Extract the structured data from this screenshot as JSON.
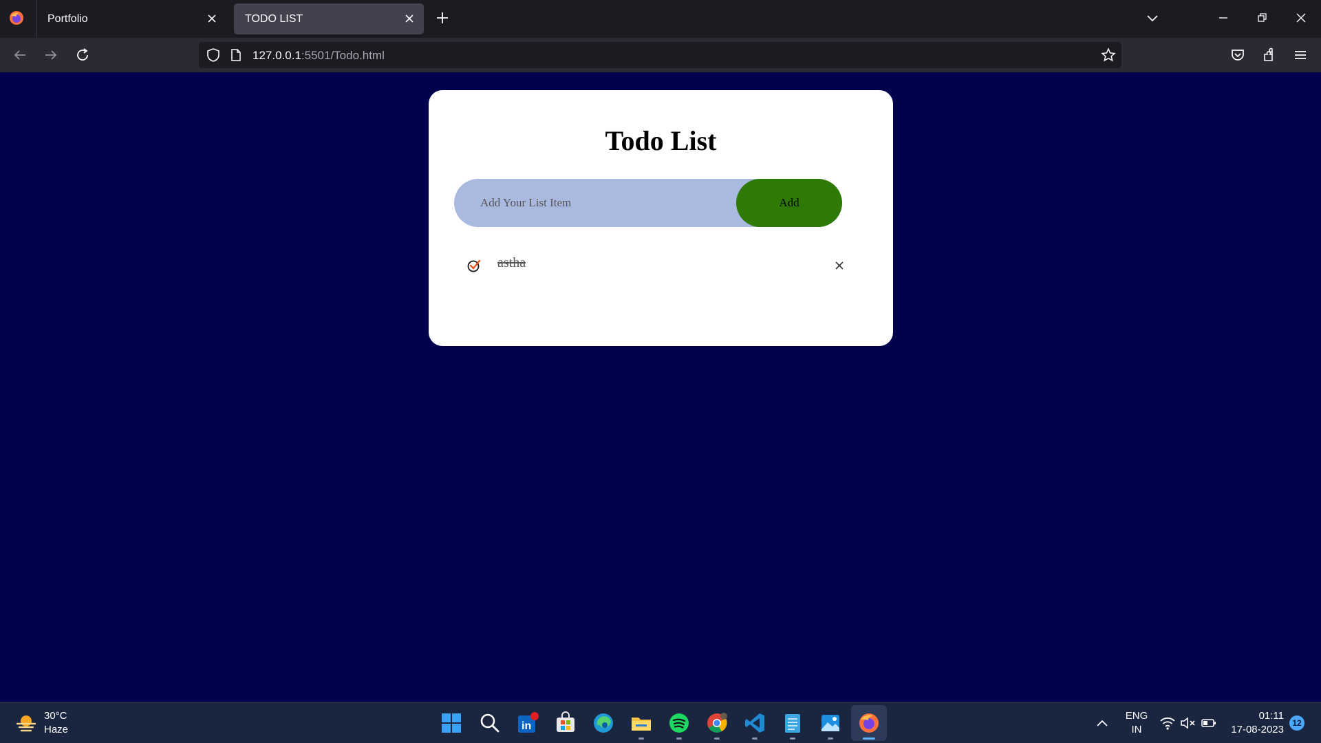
{
  "browser": {
    "tabs": [
      {
        "title": "Portfolio",
        "active": false
      },
      {
        "title": "TODO LIST",
        "active": true
      }
    ],
    "url_host": "127.0.0.1",
    "url_rest": ":5501/Todo.html"
  },
  "page": {
    "title": "Todo List",
    "input_placeholder": "Add Your List Item",
    "input_value": "",
    "add_label": "Add",
    "items": [
      {
        "text": "astha",
        "completed": true
      }
    ],
    "colors": {
      "background": "#00004d",
      "input_bg": "#a9b9e0",
      "add_button": "#2f7a06",
      "check_icon": "#e8541b"
    }
  },
  "taskbar": {
    "weather_temp": "30°C",
    "weather_desc": "Haze",
    "apps": [
      "start-icon",
      "search-icon",
      "linkedin-icon",
      "store-icon",
      "edge-icon",
      "file-explorer-icon",
      "spotify-icon",
      "chrome-icon",
      "vscode-icon",
      "notepad-icon",
      "photos-icon",
      "firefox-icon"
    ],
    "lang_top": "ENG",
    "lang_bottom": "IN",
    "time": "01:11",
    "date": "17-08-2023",
    "notification_count": "12"
  }
}
